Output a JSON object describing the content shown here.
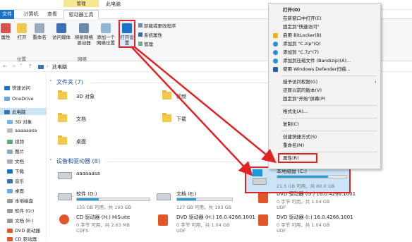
{
  "titlebar": {
    "context_tab": "管理",
    "title": "此电脑"
  },
  "tabs": [
    {
      "label": "文件"
    },
    {
      "label": "计算机"
    },
    {
      "label": "查看"
    },
    {
      "label": "驱动器工具"
    }
  ],
  "ribbon": {
    "buttons": [
      {
        "label": "属性"
      },
      {
        "label": "打开"
      },
      {
        "label": "重命名"
      },
      {
        "label": "访问媒体"
      },
      {
        "label": "映射网络驱动器"
      },
      {
        "label": "添加一个网络位置"
      },
      {
        "label": "打开设置"
      },
      {
        "label": "卸载或更改程序"
      },
      {
        "label": "系统属性"
      },
      {
        "label": "管理"
      }
    ],
    "groups": {
      "location": "位置",
      "network": "网络"
    }
  },
  "address": {
    "path": "此电脑"
  },
  "sidebar": {
    "items": [
      {
        "label": "快速访问"
      },
      {
        "label": "OneDrive"
      },
      {
        "label": "此电脑"
      },
      {
        "label": "3D 对象"
      },
      {
        "label": "aaaaaasa"
      },
      {
        "label": "视频"
      },
      {
        "label": "图片"
      },
      {
        "label": "文档"
      },
      {
        "label": "下载"
      },
      {
        "label": "音乐"
      },
      {
        "label": "桌面"
      },
      {
        "label": "本地磁盘"
      },
      {
        "label": "软件 (D:)"
      },
      {
        "label": "文档 (E:)"
      },
      {
        "label": "DVD 驱动器"
      },
      {
        "label": "CD 驱动器"
      }
    ]
  },
  "folders_section": {
    "title": "文件夹 (7)"
  },
  "folders": [
    {
      "label": "3D 对象"
    },
    {
      "label": "视频"
    },
    {
      "label": "文档"
    },
    {
      "label": "下载"
    },
    {
      "label": "桌面"
    }
  ],
  "drives_section": {
    "title": "设备和驱动器 (8)"
  },
  "drives": [
    {
      "name": "aaaaaasa",
      "sub": ""
    },
    {
      "name": "软件 (D:)",
      "sub": "135 GB 可用，共 193 GB",
      "fill": 0.3
    },
    {
      "name": "文档 (E:)",
      "sub": "127 GB 可用，共 193 GB",
      "fill": 0.34
    },
    {
      "name": "本地磁盘 (C:)",
      "sub": "21.5 GB 可用，共 80.0 GB",
      "fill": 0.73
    },
    {
      "name": "DVD 驱动器 (G:) 16.0.4266.1001",
      "sub": "0 字节 可用，共 1.04 GB",
      "sub2": "UDF"
    },
    {
      "name": "CD 驱动器 (H:) HiSuite",
      "sub": "0 字节 可用，共 2.63 MB",
      "sub2": "CDFS"
    },
    {
      "name": "DVD 驱动器 (H:) 16.0.4266.1001",
      "sub": "0 字节 可用，共 1.04 GB",
      "sub2": "UDF"
    },
    {
      "name": "DVD 驱动器 (I:) 16.0.4266.1001",
      "sub": "0 字节 可用，共 1.04 GB",
      "sub2": "UDF"
    }
  ],
  "context_menu": {
    "items": [
      {
        "label": "打开(O)"
      },
      {
        "label": "在新窗口中打开(E)"
      },
      {
        "label": "固定到\"快速访问\""
      },
      {
        "label": "启用 BitLocker(B)"
      },
      {
        "label": "添加到 \"C.zip\"(Q)"
      },
      {
        "label": "添加到 \"C.7z\"(7)"
      },
      {
        "label": "添加到压缩文件 (Bandizip)(A)..."
      },
      {
        "label": "使用 Windows Defender扫描..."
      },
      {
        "label": "授予访问权限(G)"
      },
      {
        "label": "还原以前的版本(V)"
      },
      {
        "label": "固定到\"开始\"屏幕(P)"
      },
      {
        "label": "格式化(A)..."
      },
      {
        "label": "复制(C)"
      },
      {
        "label": "创建快捷方式(S)"
      },
      {
        "label": "重命名(M)"
      },
      {
        "label": "属性(R)"
      }
    ]
  },
  "colors": {
    "accent": "#1a73c8",
    "red": "#e02424",
    "selection": "#cce4f7",
    "bar": "#26a0da"
  }
}
